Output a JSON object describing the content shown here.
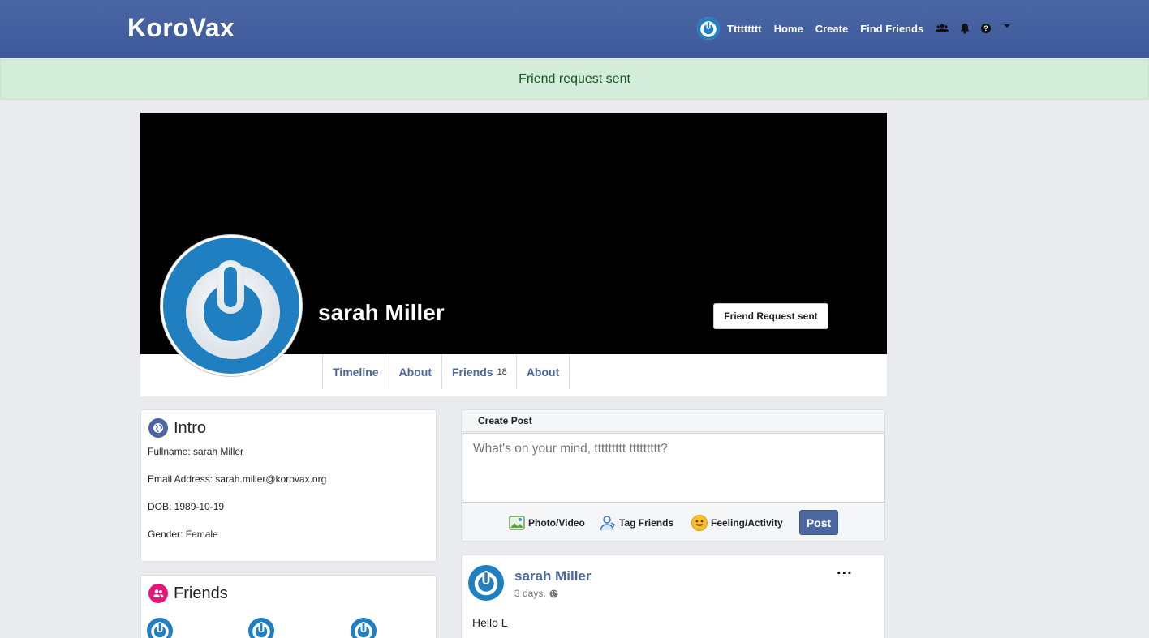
{
  "navbar": {
    "brand": "KoroVax",
    "user_name": "Ttttttttt",
    "links": [
      "Home",
      "Create",
      "Find Friends"
    ],
    "icons": [
      "friends-icon",
      "bell-icon",
      "help-icon",
      "caret-down-icon"
    ]
  },
  "alert": {
    "message": "Friend request sent"
  },
  "profile": {
    "name": "sarah Miller",
    "friend_button": "Friend Request sent",
    "tabs": {
      "timeline": "Timeline",
      "about": "About",
      "friends": "Friends",
      "friends_count": "18",
      "about2": "About"
    }
  },
  "intro": {
    "title": "Intro",
    "fullname": "Fullname: sarah Miller",
    "email": "Email Address: sarah.miller@korovax.org",
    "dob": "DOB: 1989-10-19",
    "gender": "Gender: Female"
  },
  "friends_box": {
    "title": "Friends"
  },
  "create_post": {
    "header": "Create Post",
    "placeholder": "What's on your mind, ttttttttt ttttttttt?",
    "photo": "Photo/Video",
    "tag": "Tag Friends",
    "feeling": "Feeling/Activity",
    "post_button": "Post"
  },
  "feed": {
    "author": "sarah Miller",
    "time": "3 days.",
    "more": "...",
    "body": "Hello L"
  },
  "colors": {
    "navbar": "#3d5a9a",
    "accent": "#4b67a1",
    "alert_bg": "#d4eddb",
    "avatar": "#1f7fc1"
  }
}
